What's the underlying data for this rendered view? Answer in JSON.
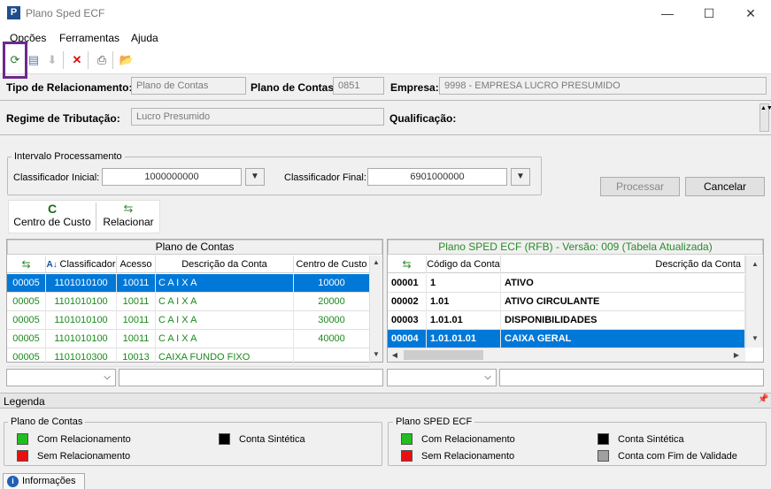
{
  "window": {
    "title": "Plano Sped ECF"
  },
  "menu": {
    "items": [
      "Opções",
      "Ferramentas",
      "Ajuda"
    ]
  },
  "header": {
    "tipo_label": "Tipo de Relacionamento:",
    "tipo_value": "Plano de Contas",
    "plano_label": "Plano de Contas:",
    "plano_value": "0851",
    "empresa_label": "Empresa:",
    "empresa_value": "9998 - EMPRESA LUCRO PRESUMIDO",
    "regime_label": "Regime de Tributação:",
    "regime_value": "Lucro Presumido",
    "qualificacao_label": "Qualificação:"
  },
  "intervalo": {
    "title": "Intervalo Processamento",
    "inicial_label": "Classificador Inicial:",
    "inicial_value": "1000000000",
    "final_label": "Classificador Final:",
    "final_value": "6901000000"
  },
  "buttons": {
    "processar": "Processar",
    "cancelar": "Cancelar",
    "centro_custo": "Centro de Custo",
    "relacionar": "Relacionar"
  },
  "left_grid": {
    "title": "Plano de Contas",
    "columns": [
      "Classificador",
      "Acesso",
      "Descrição da Conta",
      "Centro de Custo"
    ],
    "rows": [
      {
        "code": "00005",
        "classificador": "1101010100",
        "acesso": "10011",
        "descricao": "C A I X A",
        "centro": "10000",
        "selected": true
      },
      {
        "code": "00005",
        "classificador": "1101010100",
        "acesso": "10011",
        "descricao": "C A I X A",
        "centro": "20000",
        "selected": false
      },
      {
        "code": "00005",
        "classificador": "1101010100",
        "acesso": "10011",
        "descricao": "C A I X A",
        "centro": "30000",
        "selected": false
      },
      {
        "code": "00005",
        "classificador": "1101010100",
        "acesso": "10011",
        "descricao": "C A I X A",
        "centro": "40000",
        "selected": false
      },
      {
        "code": "00005",
        "classificador": "1101010300",
        "acesso": "10013",
        "descricao": "CAIXA FUNDO FIXO",
        "centro": "",
        "selected": false
      }
    ]
  },
  "right_grid": {
    "title": "Plano SPED ECF (RFB) - Versão: 009 (Tabela Atualizada)",
    "columns": [
      "Código da Conta",
      "Descrição da Conta"
    ],
    "rows": [
      {
        "code": "00001",
        "codigo": "1",
        "descricao": "ATIVO",
        "selected": false
      },
      {
        "code": "00002",
        "codigo": "1.01",
        "descricao": "ATIVO CIRCULANTE",
        "selected": false
      },
      {
        "code": "00003",
        "codigo": "1.01.01",
        "descricao": "DISPONIBILIDADES",
        "selected": false
      },
      {
        "code": "00004",
        "codigo": "1.01.01.01",
        "descricao": "CAIXA GERAL",
        "selected": true
      }
    ]
  },
  "legenda": {
    "title": "Legenda",
    "left_title": "Plano de Contas",
    "right_title": "Plano SPED ECF",
    "com": "Com Relacionamento",
    "sem": "Sem Relacionamento",
    "sintetica": "Conta Sintética",
    "fim_validade": "Conta com Fim de Validade"
  },
  "status": {
    "info_tab": "Informações"
  },
  "colors": {
    "selected": "#0078d7",
    "green_text": "#1a8a1a",
    "green_sq": "#1fbf1f",
    "red_sq": "#e81010",
    "title_green": "#2a8a2a",
    "highlight": "#6b2a8c"
  }
}
